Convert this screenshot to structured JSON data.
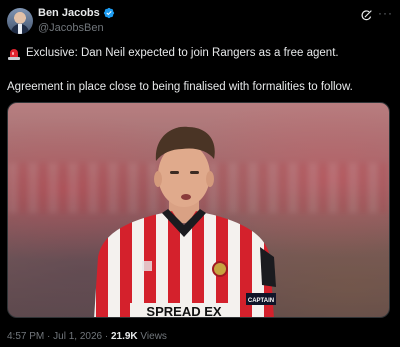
{
  "author": {
    "display_name": "Ben Jacobs",
    "handle": "@JacobsBen",
    "verified": true
  },
  "icons": {
    "verified": "verified-badge-icon",
    "grok": "grok-icon",
    "more": "more-options-icon",
    "siren": "police-light-emoji"
  },
  "tweet": {
    "line1": "Exclusive: Dan Neil expected to join Rangers as a free agent.",
    "line2": "Agreement in place close to being finalised with formalities to follow."
  },
  "media": {
    "sponsor_text": "SPREAD EX",
    "armband_text": "CAPTAIN"
  },
  "meta": {
    "time": "4:57 PM",
    "sep1": " · ",
    "date": "Jul 1, 2026",
    "sep2": " · ",
    "views_count": "21.9K",
    "views_label": " Views"
  },
  "colors": {
    "background": "#000000",
    "text": "#e7e9ea",
    "secondary": "#71767b",
    "verified": "#1d9bf0",
    "shirt_red": "#d4212c"
  }
}
